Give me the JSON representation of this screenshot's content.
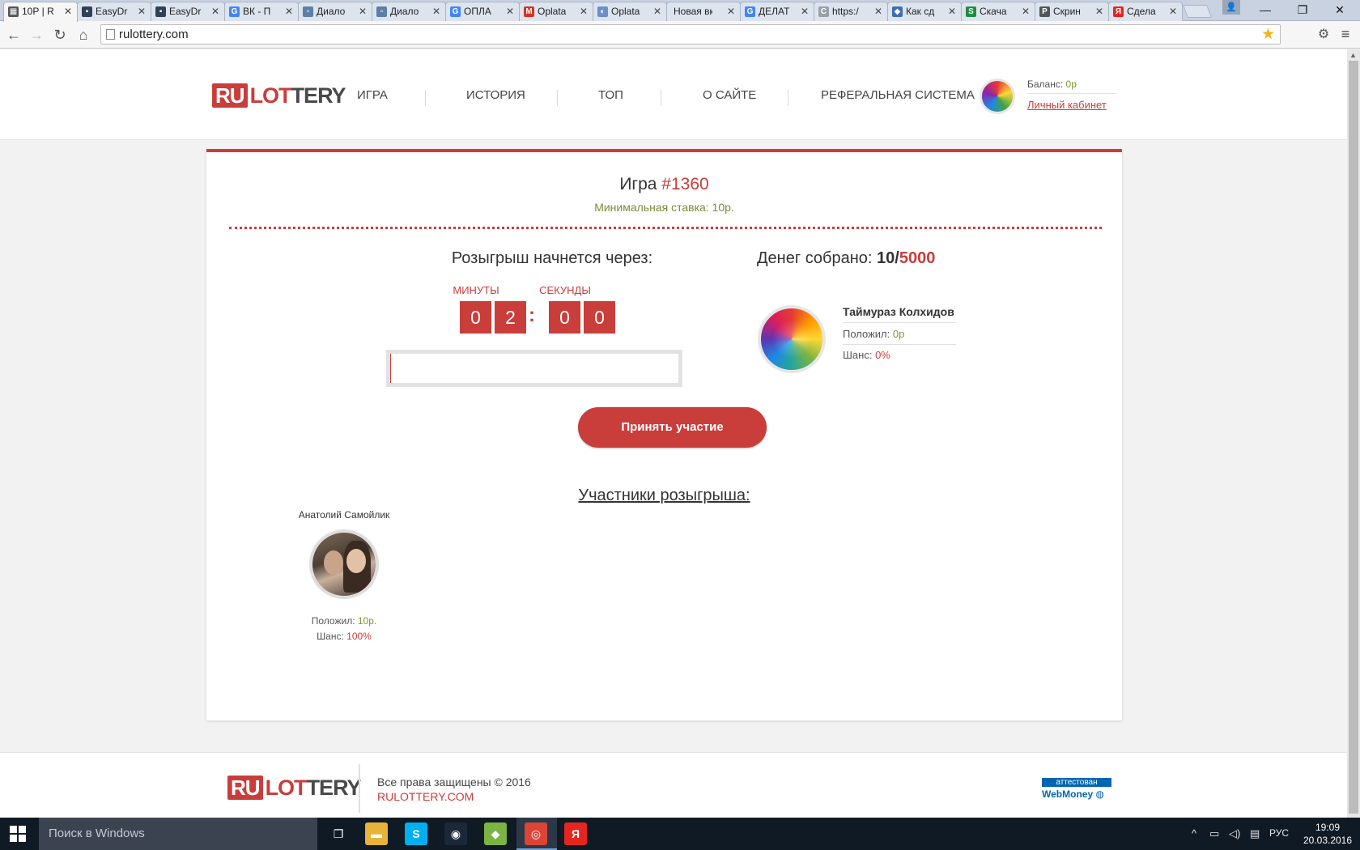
{
  "browser": {
    "tabs": [
      {
        "label": "10Р | R",
        "icon": "lottery-favicon",
        "color": "#555555",
        "glyph": "▦",
        "active": true
      },
      {
        "label": "EasyDr",
        "icon": "easydrop-favicon",
        "color": "#2f4157",
        "glyph": "▪"
      },
      {
        "label": "EasyDr",
        "icon": "easydrop-favicon",
        "color": "#2f4157",
        "glyph": "▪"
      },
      {
        "label": "ВК - П",
        "icon": "google-favicon",
        "color": "#4285f4",
        "glyph": "G"
      },
      {
        "label": "Диало",
        "icon": "vk-dialog-favicon",
        "color": "#5b7fa6",
        "glyph": "▫"
      },
      {
        "label": "Диало",
        "icon": "vk-dialog-favicon",
        "color": "#5b7fa6",
        "glyph": "▫"
      },
      {
        "label": "ОПЛА",
        "icon": "google-favicon",
        "color": "#4285f4",
        "glyph": "G"
      },
      {
        "label": "Oplata",
        "icon": "gmail-favicon",
        "color": "#d93025",
        "glyph": "M"
      },
      {
        "label": "Oplata",
        "icon": "globe-favicon",
        "color": "#6b8fc9",
        "glyph": "◐"
      },
      {
        "label": "Новая вкл",
        "icon": "",
        "color": "",
        "glyph": ""
      },
      {
        "label": "ДЕЛАТ",
        "icon": "google-favicon",
        "color": "#4285f4",
        "glyph": "G"
      },
      {
        "label": "https:/",
        "icon": "loading-favicon",
        "color": "#9aa0a6",
        "glyph": "C"
      },
      {
        "label": "Как сд",
        "icon": "tool-favicon",
        "color": "#3e6fb3",
        "glyph": "◆"
      },
      {
        "label": "Скача",
        "icon": "sheet-favicon",
        "color": "#1e8e3e",
        "glyph": "S"
      },
      {
        "label": "Скрин",
        "icon": "p-favicon",
        "color": "#555555",
        "glyph": "P"
      },
      {
        "label": "Сдела",
        "icon": "yandex-favicon",
        "color": "#e52620",
        "glyph": "Я"
      }
    ],
    "url": "rulottery.com"
  },
  "header": {
    "logo": {
      "ru": "RU",
      "lot": "LOT",
      "tery": "TERY"
    },
    "nav": [
      "ИГРА",
      "ИСТОРИЯ",
      "ТОП",
      "О САЙТЕ",
      "РЕФЕРАЛЬНАЯ СИСТЕМА"
    ],
    "balance_label": "Баланс:",
    "balance_value": "0р",
    "cabinet_link": "Личный кабинет"
  },
  "game": {
    "title_prefix": "Игра",
    "number": "#1360",
    "min_bet": "Минимальная ставка: 10р.",
    "draw_label": "Розыгрыш начнется через:",
    "minutes_label": "МИНУТЫ",
    "seconds_label": "СЕКУНДЫ",
    "digits": [
      "0",
      "2",
      "0",
      "0"
    ],
    "colon": ":",
    "money_label": "Денег собрано:",
    "money_collected": "10",
    "money_separator": "/",
    "money_target": "5000",
    "progress_fraction": 0.002,
    "current_user": {
      "name": "Таймураз Колхидов",
      "deposit_label": "Положил:",
      "deposit_value": "0р",
      "chance_label": "Шанс:",
      "chance_value": "0%"
    },
    "join_button": "Принять участие",
    "participants_title": "Участники розыгрыша:",
    "participants": [
      {
        "name": "Анатолий Самойлик",
        "deposit_label": "Положил:",
        "deposit_value": "10р.",
        "chance_label": "Шанс:",
        "chance_value": "100%"
      }
    ]
  },
  "footer": {
    "logo": {
      "ru": "RU",
      "lot": "LOT",
      "tery": "TERY"
    },
    "copyright": "Все права защищены © 2016",
    "site": "RULOTTERY.COM",
    "webmoney_badge": "аттестован",
    "webmoney_text": "WebMoney"
  },
  "taskbar": {
    "search_placeholder": "Поиск в Windows",
    "apps": [
      {
        "name": "task-view-icon",
        "glyph": "❐",
        "color": ""
      },
      {
        "name": "file-explorer-icon",
        "glyph": "▬",
        "color": "#e8b339"
      },
      {
        "name": "skype-icon",
        "glyph": "S",
        "color": "#00aff0"
      },
      {
        "name": "steam-icon",
        "glyph": "◉",
        "color": "#1b2838"
      },
      {
        "name": "bluestacks-icon",
        "glyph": "◆",
        "color": "#7cb342"
      },
      {
        "name": "chrome-icon",
        "glyph": "◎",
        "color": "#db4437"
      },
      {
        "name": "yandex-browser-icon",
        "glyph": "Я",
        "color": "#e52620"
      }
    ],
    "language": "РУС",
    "time": "19:09",
    "date": "20.03.2016"
  },
  "colors": {
    "brand": "#c93d3b",
    "positive": "#7a9a2d"
  }
}
